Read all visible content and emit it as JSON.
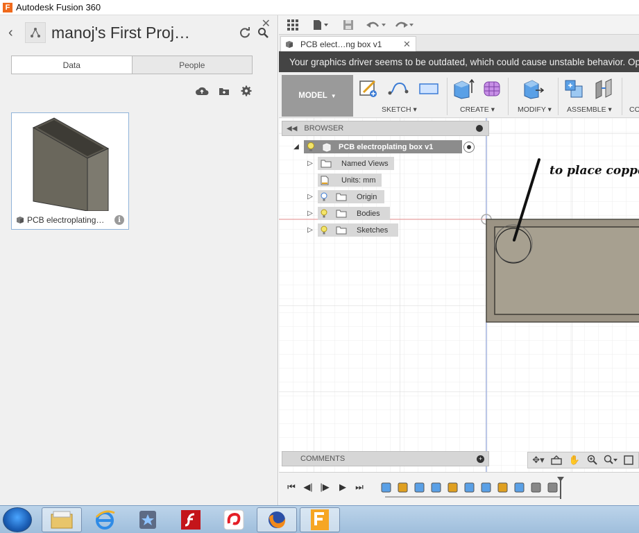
{
  "window": {
    "title": "Autodesk Fusion 360",
    "logo_letter": "F"
  },
  "data_panel": {
    "project_title": "manoj's First Proj…",
    "tabs": [
      {
        "label": "Data",
        "active": true
      },
      {
        "label": "People",
        "active": false
      }
    ],
    "actions": [
      "upload-cloud-icon",
      "new-folder-icon",
      "settings-gear-icon"
    ],
    "file_card": {
      "name": "PCB electroplating…",
      "info_glyph": "i"
    }
  },
  "quick_access": [
    "grid-menu-icon",
    "file-menu-icon",
    "save-icon",
    "undo-icon",
    "redo-icon"
  ],
  "document_tab": {
    "title": "PCB elect…ng box v1"
  },
  "warning_banner": {
    "text": "Your graphics driver seems to be outdated, which could cause unstable behavior. Open"
  },
  "toolbar": {
    "workspace": "MODEL",
    "groups": [
      {
        "label": "SKETCH"
      },
      {
        "label": "CREATE"
      },
      {
        "label": "MODIFY"
      },
      {
        "label": "ASSEMBLE"
      },
      {
        "label": "CO"
      }
    ]
  },
  "browser": {
    "header": "BROWSER",
    "root": "PCB electroplating box v1",
    "items": [
      {
        "label": "Named Views",
        "has_bulb": false
      },
      {
        "label": "Units: mm",
        "has_bulb": false
      },
      {
        "label": "Origin",
        "has_bulb": true
      },
      {
        "label": "Bodies",
        "has_bulb": true
      },
      {
        "label": "Sketches",
        "has_bulb": true
      }
    ]
  },
  "annotation": {
    "text": "to place copper"
  },
  "comments": {
    "label": "COMMENTS"
  },
  "navigation_bar": [
    "orbit-icon",
    "look-at-icon",
    "pan-hand-icon",
    "zoom-icon",
    "zoom-window-icon",
    "display-icon"
  ],
  "timeline": {
    "controls": [
      "go-to-start-icon",
      "step-back-icon",
      "play-icon",
      "step-forward-icon",
      "go-to-end-icon"
    ]
  },
  "taskbar": {
    "apps": [
      "windows-start",
      "file-explorer",
      "internet-explorer",
      "favorites-app",
      "flash-player",
      "airtel-app",
      "firefox",
      "fusion-360"
    ]
  },
  "colors": {
    "warning_bg": "#444444",
    "model_button": "#9a9a9a",
    "body_fill": "#9b9384",
    "accent_red_axis": "#e08a8a",
    "accent_blue_axis": "#8aa0e0"
  }
}
